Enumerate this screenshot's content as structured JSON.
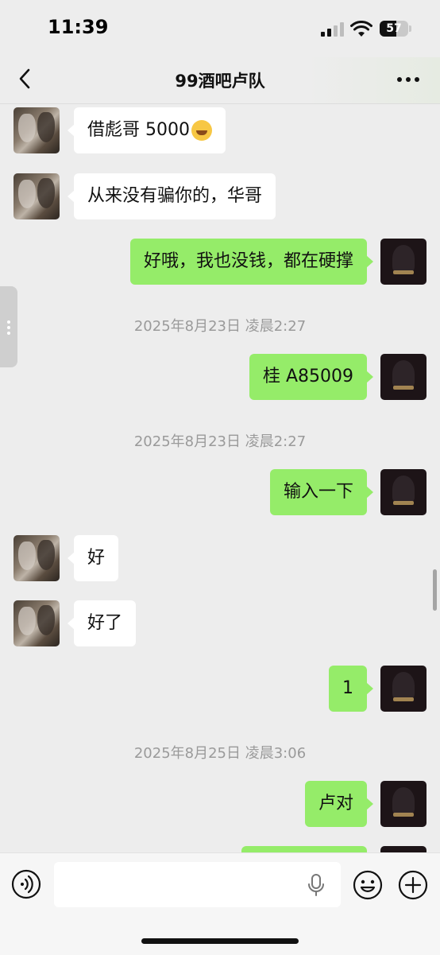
{
  "status": {
    "time": "11:39",
    "battery": "57"
  },
  "nav": {
    "title": "99酒吧卢队",
    "back_icon": "chevron-left-icon",
    "more_icon": "more-horizontal-icon"
  },
  "messages": [
    {
      "side": "in",
      "text": "借彪哥 5000",
      "emoji": "laughing-crying-emoji"
    },
    {
      "side": "in",
      "text": "从来没有骗你的，华哥"
    },
    {
      "side": "out",
      "text": "好哦，我也没钱，都在硬撑"
    },
    {
      "timestamp": "2025年8月23日 凌晨2:27"
    },
    {
      "side": "out",
      "text": "桂 A85009"
    },
    {
      "timestamp": "2025年8月23日 凌晨2:27"
    },
    {
      "side": "out",
      "text": "输入一下"
    },
    {
      "side": "in",
      "text": "好"
    },
    {
      "side": "in",
      "text": "好了"
    },
    {
      "side": "out",
      "text": "1"
    },
    {
      "timestamp": "2025年8月25日 凌晨3:06"
    },
    {
      "side": "out",
      "text": "卢对"
    },
    {
      "side": "out",
      "text": ""
    }
  ],
  "input": {
    "value": "",
    "placeholder": ""
  },
  "colors": {
    "outgoing_bubble": "#95ec69",
    "incoming_bubble": "#ffffff",
    "background": "#ededed"
  }
}
